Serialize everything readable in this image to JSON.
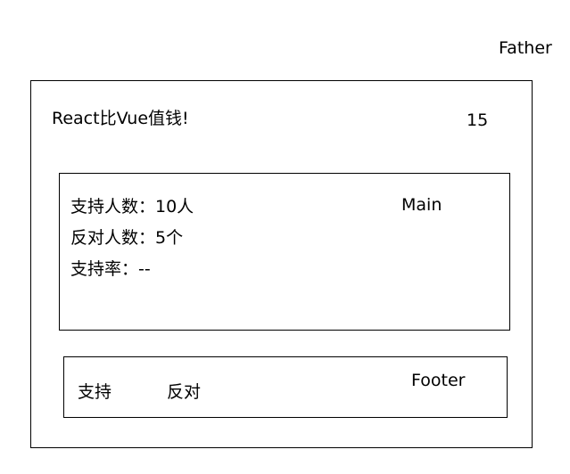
{
  "father": {
    "label": "Father",
    "title": "React比Vue值钱!",
    "count": "15"
  },
  "main": {
    "label": "Main",
    "support_count": "支持人数：10人",
    "oppose_count": "反对人数：5个",
    "support_rate": "支持率：--"
  },
  "footer": {
    "label": "Footer",
    "support_button": "支持",
    "oppose_button": "反对"
  }
}
